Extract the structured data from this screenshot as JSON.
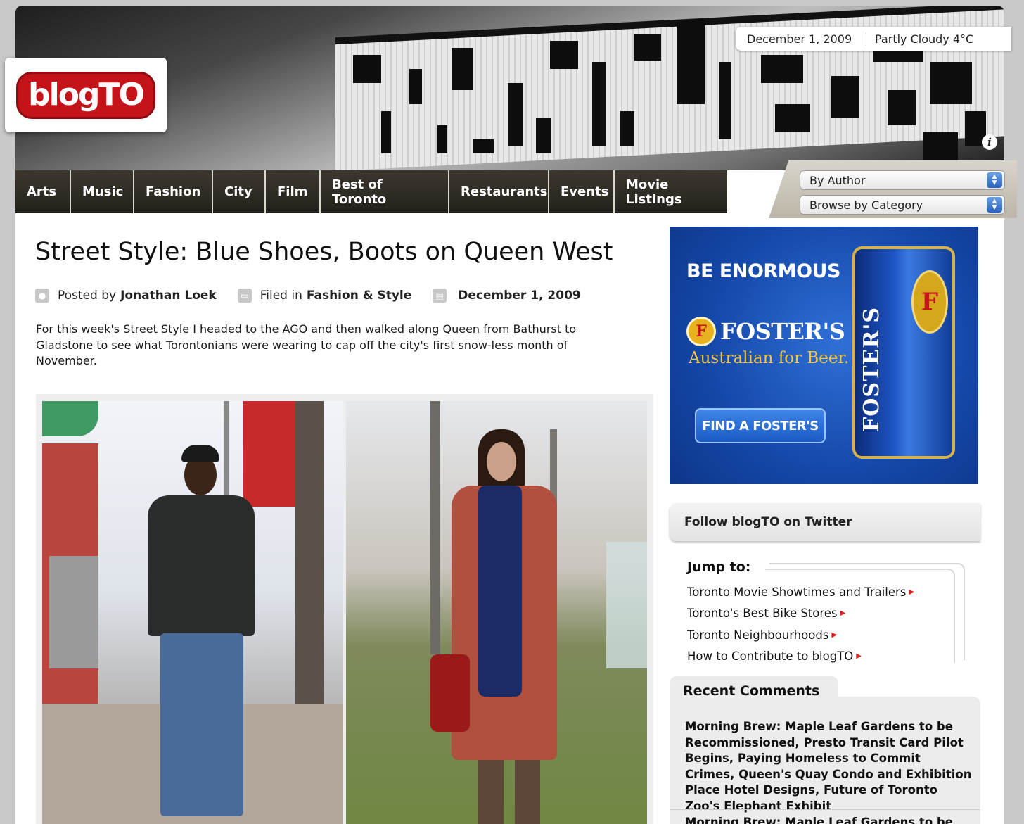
{
  "header": {
    "logo_text": "blogTO",
    "date": "December 1, 2009",
    "weather": "Partly Cloudy 4°C",
    "info_icon": "i"
  },
  "nav": {
    "items": [
      "Arts",
      "Music",
      "Fashion",
      "City",
      "Film",
      "Best of Toronto",
      "Restaurants",
      "Events",
      "Movie Listings"
    ],
    "author_select": "By Author",
    "category_select": "Browse by Category"
  },
  "article": {
    "title": "Street Style: Blue Shoes, Boots on Queen West",
    "posted_by_label": "Posted by",
    "author": "Jonathan Loek",
    "filed_in_label": "Filed in",
    "category": "Fashion & Style",
    "date": "December 1, 2009",
    "intro": "For this week's Street Style I headed to the AGO and then walked along Queen from Bathurst to Gladstone to see what Torontonians were wearing to cap off the city's first snow-less month of November."
  },
  "ad": {
    "headline": "BE ENORMOUS",
    "brand": "FOSTER'S",
    "brand_badge": "F",
    "tagline": "Australian for Beer.",
    "button": "FIND A FOSTER'S",
    "can_text": "FOSTER'S"
  },
  "sidebar": {
    "twitter": "Follow blogTO on Twitter",
    "jump_title": "Jump to:",
    "jump_links": [
      "Toronto Movie Showtimes and Trailers",
      "Toronto's Best Bike Stores",
      "Toronto Neighbourhoods",
      "How to Contribute to blogTO"
    ],
    "recent_comments_title": "Recent Comments",
    "comments": [
      "Morning Brew: Maple Leaf Gardens to be Recommissioned, Presto Transit Card Pilot Begins, Paying Homeless to Commit Crimes, Queen's Quay Condo and Exhibition Place Hotel Designs, Future of Toronto Zoo's Elephant Exhibit",
      "Morning Brew: Maple Leaf Gardens to be"
    ]
  },
  "colors": {
    "brand_red": "#c4141a",
    "nav_bg": "#2b2822",
    "ad_blue": "#1447a8",
    "ad_gold": "#f4c53d",
    "link_arrow": "#e01c1c"
  }
}
